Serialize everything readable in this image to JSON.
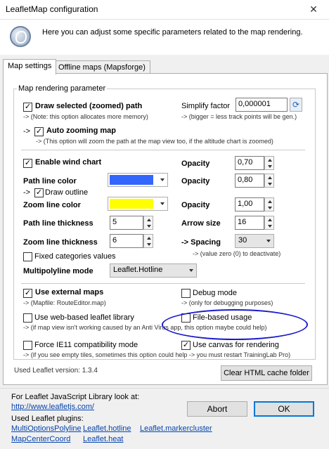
{
  "window": {
    "title": "LeafletMap configuration",
    "close_glyph": "✕"
  },
  "header": {
    "text": "Here you can adjust some specific parameters related to the map rendering."
  },
  "tabs": [
    {
      "label": "Map settings"
    },
    {
      "label": "Offline maps (Mapsforge)"
    }
  ],
  "group": {
    "title": "Map rendering parameter"
  },
  "draw_path": {
    "label": "Draw selected (zoomed) path",
    "note": "-> (Note: this option allocates more memory)",
    "checked": true
  },
  "simplify": {
    "label": "Simplify factor",
    "value": "0,000001",
    "note": "-> (bigger = less track points will be gen.)"
  },
  "auto_zoom": {
    "arrow": "->",
    "label": "Auto zooming map",
    "note": "-> (This option will zoom the path at the map view too, if the altitude chart is zoomed)",
    "checked": true
  },
  "wind": {
    "label": "Enable wind chart",
    "checked": true
  },
  "opacity1": {
    "label": "Opacity",
    "value": "0,70"
  },
  "path_color": {
    "label": "Path line color",
    "color": "#3366ff"
  },
  "opacity2": {
    "label": "Opacity",
    "value": "0,80"
  },
  "draw_outline": {
    "arrow": "->",
    "label": "Draw outline",
    "checked": true
  },
  "zoom_color": {
    "label": "Zoom line color",
    "color": "#ffff00"
  },
  "opacity3": {
    "label": "Opacity",
    "value": "1,00"
  },
  "path_thickness": {
    "label": "Path line thickness",
    "value": "5"
  },
  "arrow_size": {
    "label": "Arrow size",
    "value": "16"
  },
  "zoom_thickness": {
    "label": "Zoom line thickness",
    "value": "6"
  },
  "spacing": {
    "label": "-> Spacing",
    "value": "30",
    "note": "-> (value zero (0) to deactivate)"
  },
  "fixed_categories": {
    "label": "Fixed categories values",
    "checked": false
  },
  "multipolyline": {
    "label": "Multipolyline mode",
    "value": "Leaflet.Hotline"
  },
  "external_maps": {
    "label": "Use external maps",
    "note": "-> (Mapfile: RouteEditor.map)",
    "checked": true
  },
  "debug": {
    "label": "Debug mode",
    "note": "-> (only for debugging purposes)",
    "checked": false
  },
  "web_leaflet": {
    "label": "Use web-based leaflet library",
    "note": "-> (if map view isn't working caused by an Anti Virus app, this option maybe could help)",
    "checked": false
  },
  "file_usage": {
    "label": "File-based usage",
    "checked": false
  },
  "ie11": {
    "label": "Force IE11 compatibility mode",
    "note": "-> (if you see empty tiles, sometimes this option could help -> you must restart TrainingLab Pro)",
    "checked": false
  },
  "canvas": {
    "label": "Use canvas for rendering",
    "checked": true
  },
  "version": {
    "text": "Used Leaflet version: 1.3.4"
  },
  "clear_cache": {
    "label": "Clear HTML cache folder"
  },
  "footer": {
    "info": "For Leaflet JavaScript Library look at:",
    "site_link": "http://www.leafletjs.com/",
    "plugins_label": "Used Leaflet plugins:",
    "plugins": [
      "MultiOptionsPolyline",
      "Leaflet.hotline",
      "Leaflet.markercluster",
      "MapCenterCoord",
      "Leaflet.heat"
    ]
  },
  "buttons": {
    "abort": "Abort",
    "ok": "OK"
  },
  "check_glyph": "✓",
  "icons": {
    "app": "globe-icon",
    "refresh": "refresh-icon"
  },
  "colors": {
    "highlight_ellipse": "#1a1acc",
    "link": "#0645ad",
    "default_button": "#0078d7"
  }
}
